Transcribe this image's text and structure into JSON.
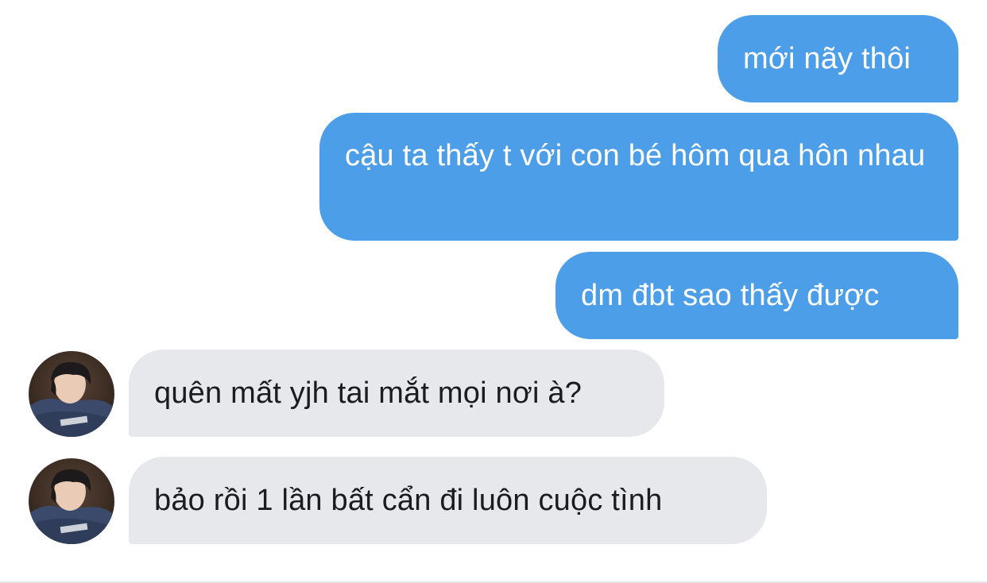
{
  "messages": [
    {
      "side": "sent",
      "text": "mới nãy thôi"
    },
    {
      "side": "sent",
      "text": "cậu ta thấy t với con bé hôm qua hôn nhau"
    },
    {
      "side": "sent",
      "text": "dm đbt sao thấy được"
    },
    {
      "side": "received",
      "text": "quên mất yjh tai mắt mọi nơi à?"
    },
    {
      "side": "received",
      "text": "bảo rồi 1 lần bất cẩn đi luôn cuộc tình"
    }
  ],
  "colors": {
    "sent_bubble": "#4c9ee8",
    "sent_text": "#ffffff",
    "received_bubble": "#e7e8ec",
    "received_text": "#1b1c1f",
    "background": "#ffffff"
  },
  "avatar": {
    "icon": "avatar-photo",
    "shirt_text": "BALENCIAGA"
  }
}
